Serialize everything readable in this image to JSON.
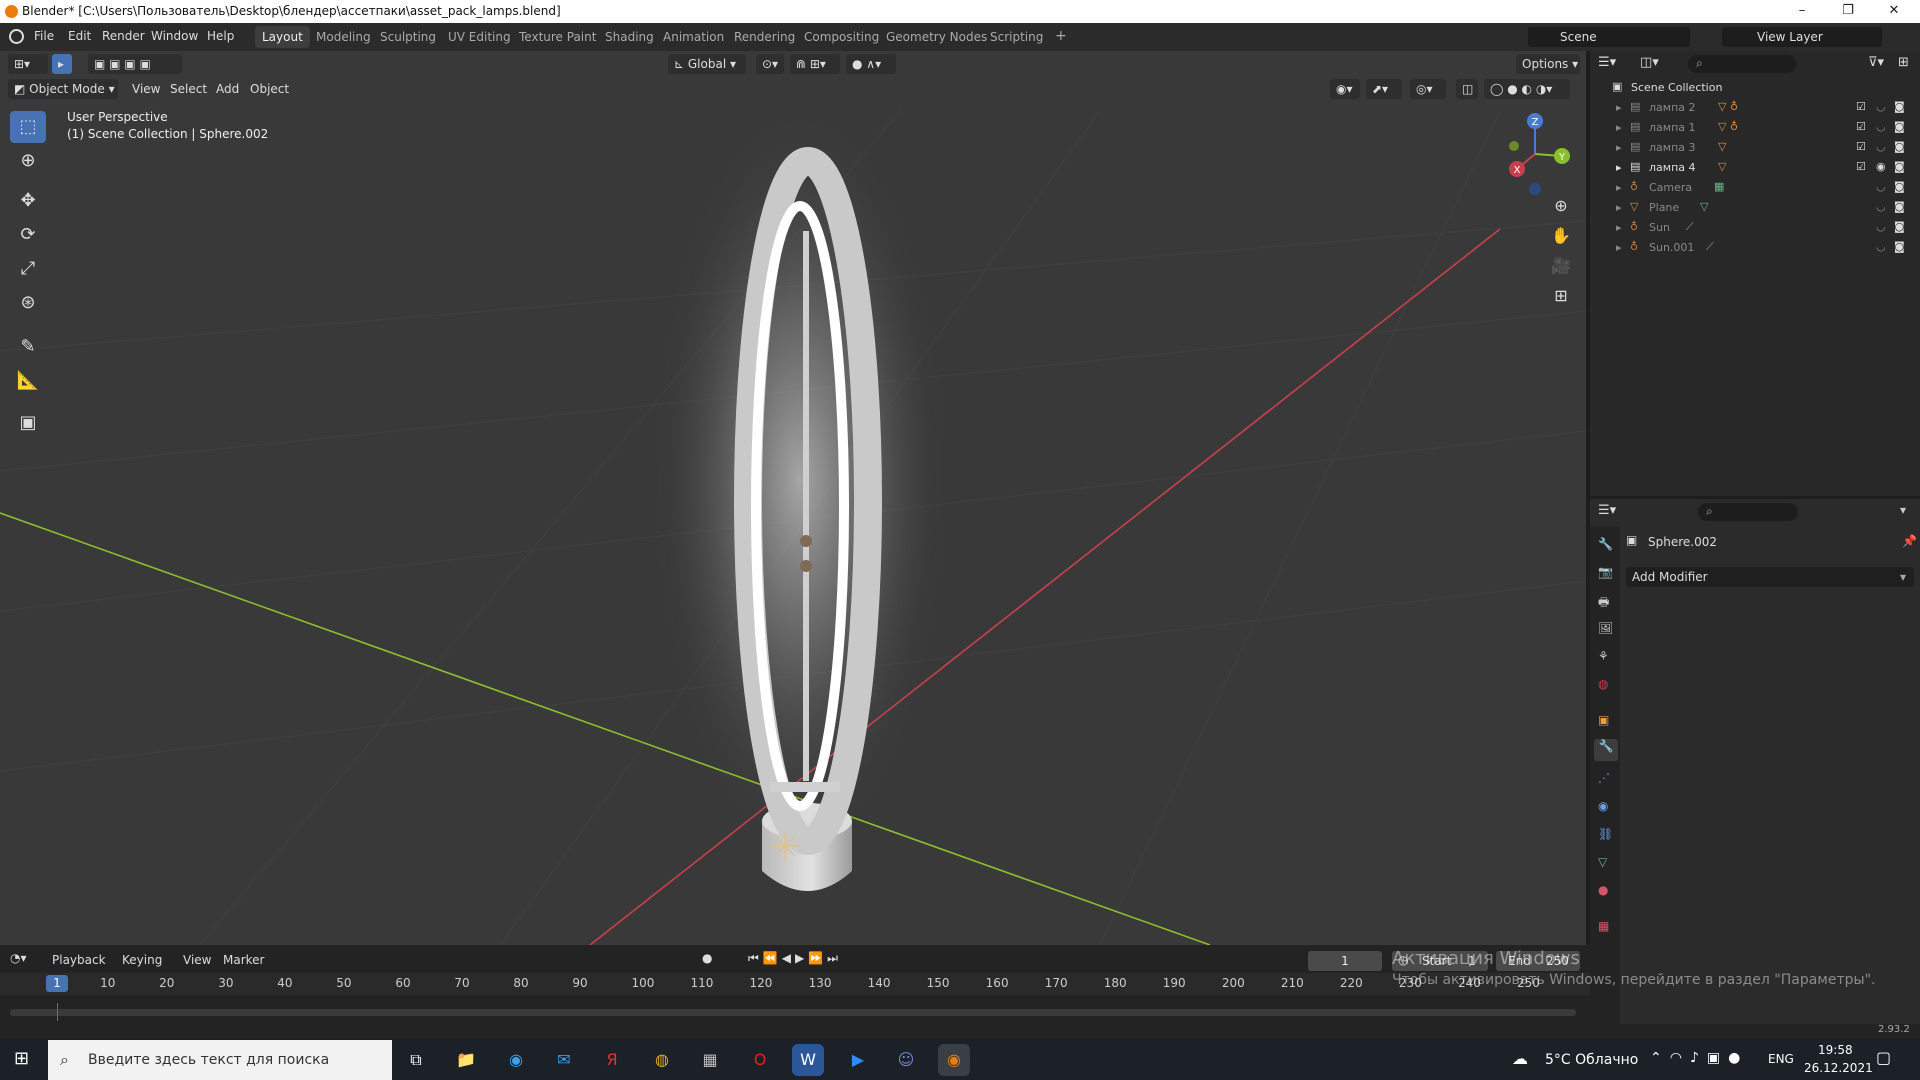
{
  "window": {
    "title": "Blender* [C:\\Users\\Пользователь\\Desktop\\блендер\\ассетпаки\\asset_pack_lamps.blend]",
    "minimize": "–",
    "maximize": "❐",
    "close": "✕"
  },
  "menu": [
    "File",
    "Edit",
    "Render",
    "Window",
    "Help"
  ],
  "workspaces": [
    "Layout",
    "Modeling",
    "Sculpting",
    "UV Editing",
    "Texture Paint",
    "Shading",
    "Animation",
    "Rendering",
    "Compositing",
    "Geometry Nodes",
    "Scripting"
  ],
  "active_workspace": "Layout",
  "scene": {
    "label": "Scene",
    "view_layer": "View Layer"
  },
  "viewport_header": {
    "mode": "Object Mode",
    "menus": [
      "View",
      "Select",
      "Add",
      "Object"
    ],
    "transform_orientation": "Global",
    "options": "Options"
  },
  "viewport": {
    "perspective": "User Perspective",
    "collection_info": "(1) Scene Collection | Sphere.002",
    "gizmo_axes": {
      "z": "Z",
      "y": "Y",
      "x": "X"
    }
  },
  "outliner": {
    "root": "Scene Collection",
    "items": [
      {
        "name": "лампа 2",
        "enabled": true,
        "visible": false
      },
      {
        "name": "лампа 1",
        "enabled": true,
        "visible": false
      },
      {
        "name": "лампа 3",
        "enabled": true,
        "visible": false
      },
      {
        "name": "лампа 4",
        "enabled": true,
        "visible": true
      },
      {
        "name": "Camera",
        "enabled": false,
        "visible": false
      },
      {
        "name": "Plane",
        "enabled": false,
        "visible": false
      },
      {
        "name": "Sun",
        "enabled": false,
        "visible": false
      },
      {
        "name": "Sun.001",
        "enabled": false,
        "visible": false
      }
    ]
  },
  "properties": {
    "object_name": "Sphere.002",
    "add_modifier": "Add Modifier"
  },
  "timeline": {
    "menus": [
      "Playback",
      "Keying",
      "View",
      "Marker"
    ],
    "current_frame": "1",
    "start_label": "Start",
    "start_value": "1",
    "end_label": "End",
    "end_value": "250",
    "ticks": [
      "1",
      "10",
      "20",
      "30",
      "40",
      "50",
      "60",
      "70",
      "80",
      "90",
      "100",
      "110",
      "120",
      "130",
      "140",
      "150",
      "160",
      "170",
      "180",
      "190",
      "200",
      "210",
      "220",
      "230",
      "240",
      "250"
    ]
  },
  "watermark": {
    "line1": "Активация Windows",
    "line2": "Чтобы активировать Windows, перейдите в раздел \"Параметры\"."
  },
  "status": {
    "version": "2.93.2"
  },
  "taskbar": {
    "search_placeholder": "Введите здесь текст для поиска",
    "weather": "5°C Облачно",
    "lang": "ENG",
    "time": "19:58",
    "date": "26.12.2021"
  },
  "colors": {
    "accent": "#4772b3",
    "x_axis": "#c9404d",
    "y_axis": "#8bbf2c",
    "z_axis": "#4a7bd4",
    "active_tab": "#3d3d3d",
    "blender_orange": "#e87d0d"
  }
}
